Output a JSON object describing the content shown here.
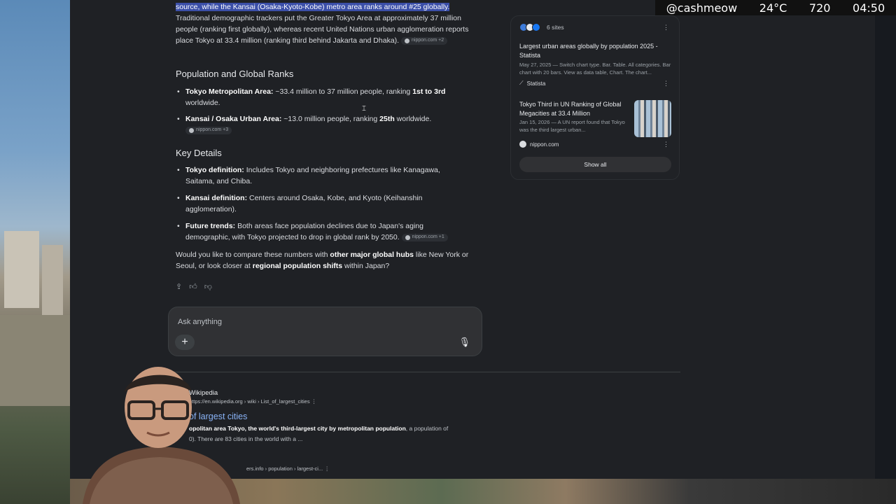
{
  "overlay": {
    "handle": "@cashmeow",
    "temp": "24°C",
    "num": "720",
    "time": "04:50"
  },
  "answer": {
    "intro_highlight": "source, while the Kansai (Osaka-Kyoto-Kobe) metro area ranks around #25 globally",
    "intro_rest": "Traditional demographic trackers put the Greater Tokyo Area at approximately 37 million people (ranking first globally), whereas recent United Nations urban agglomeration reports place Tokyo at 33.4 million (ranking third behind Jakarta and Dhaka).",
    "intro_chip": "nippon.com +2",
    "h_population": "Population and Global Ranks",
    "pop_items": [
      {
        "label": "Tokyo Metropolitan Area:",
        "text1": " ~33.4 million to 37 million people, ranking ",
        "bold2": "1st to 3rd",
        "text2": " worldwide.",
        "chip": ""
      },
      {
        "label": "Kansai / Osaka Urban Area:",
        "text1": " ~13.0 million people, ranking ",
        "bold2": "25th",
        "text2": " worldwide.",
        "chip": "nippon.com +3"
      }
    ],
    "h_details": "Key Details",
    "detail_items": [
      {
        "label": "Tokyo definition:",
        "text": " Includes Tokyo and neighboring prefectures like Kanagawa, Saitama, and Chiba.",
        "chip": ""
      },
      {
        "label": "Kansai definition:",
        "text": " Centers around Osaka, Kobe, and Kyoto (Keihanshin agglomeration).",
        "chip": ""
      },
      {
        "label": "Future trends:",
        "text": " Both areas face population declines due to Japan's aging demographic, with Tokyo projected to drop in global rank by 2050.",
        "chip": "nippon.com +1"
      }
    ],
    "closing_1": "Would you like to compare these numbers with ",
    "closing_b1": "other major global hubs",
    "closing_2": " like New York or Seoul, or look closer at ",
    "closing_b2": "regional population shifts",
    "closing_3": " within Japan?"
  },
  "ask": {
    "placeholder": "Ask anything"
  },
  "side": {
    "sites_count": "6 sites",
    "cards": [
      {
        "title": "Largest urban areas globally by population 2025 - Statista",
        "snippet": "May 27, 2025 — Switch chart type. Bar. Table. All categories. Bar chart with 20 bars. View as data table, Chart. The chart...",
        "source": "Statista"
      },
      {
        "title": "Tokyo Third in UN Ranking of Global Megacities at 33.4 Million",
        "snippet": "Jan 15, 2026 — A UN report found that Tokyo was the third largest urban...",
        "source": "nippon.com"
      }
    ],
    "show_all": "Show all"
  },
  "result": {
    "site": "Wikipedia",
    "url": "https://en.wikipedia.org › wiki › List_of_largest_cities",
    "title": "of largest cities",
    "snippet_bold": "opolitan area Tokyo, the world's third-largest city by metropolitan population",
    "snippet_rest": ", a population of",
    "snippet_2": "0). There are 83 cities in the world with a ...",
    "url2": "ers.info › population › largest-ci..."
  },
  "colors": {
    "accent_link": "#8ab4f8",
    "highlight": "#3b4fa8",
    "bg": "#1f2125"
  }
}
